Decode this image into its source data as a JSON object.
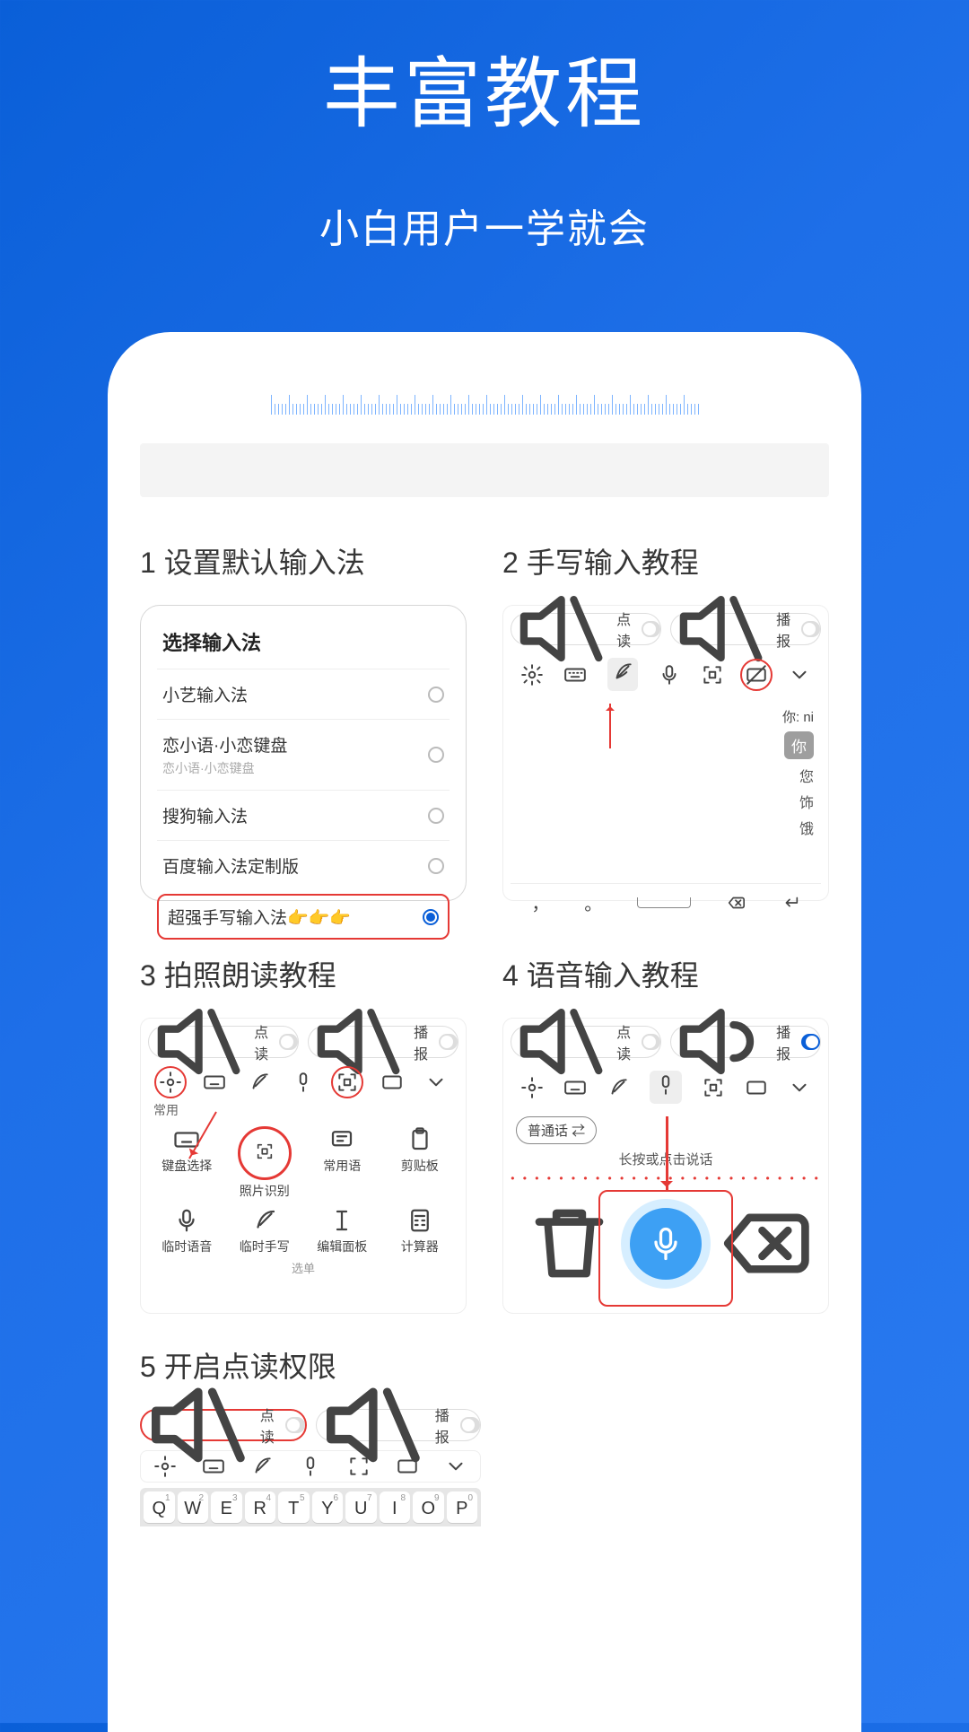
{
  "hero": {
    "title": "丰富教程",
    "subtitle": "小白用户一学就会"
  },
  "tiles": {
    "t1": {
      "title": "1 设置默认输入法",
      "header": "选择输入法",
      "row1": "小艺输入法",
      "row2": "恋小语·小恋键盘",
      "row2sub": "恋小语·小恋键盘",
      "row3": "搜狗输入法",
      "row4": "百度输入法定制版",
      "row5": "超强手写输入法👉👉👉"
    },
    "t2": {
      "title": "2 手写输入教程",
      "toggle1": "点读",
      "toggle2": "播报",
      "pinyin_label": "你: ni",
      "c1": "你",
      "c2": "您",
      "c3": "饰",
      "c4": "饿",
      "f1": "，",
      "f2": "。"
    },
    "t3": {
      "title": "3 拍照朗读教程",
      "tab": "常用",
      "toggle1": "点读",
      "toggle2": "播报",
      "g1": "键盘选择",
      "g2": "照片识别",
      "g3": "常用语",
      "g4": "剪贴板",
      "g5": "临时语音",
      "g6": "临时手写",
      "g7": "编辑面板",
      "g8": "计算器",
      "more": "选单"
    },
    "t4": {
      "title": "4 语音输入教程",
      "toggle1": "点读",
      "toggle2": "播报",
      "chip": "普通话 ⇄",
      "hint": "长按或点击说话"
    },
    "t5": {
      "title": "5 开启点读权限",
      "toggle1": "点读",
      "toggle2": "播报",
      "keys": [
        "Q",
        "W",
        "E",
        "R",
        "T",
        "Y",
        "U",
        "I",
        "O",
        "P"
      ],
      "sups": [
        "1",
        "2",
        "3",
        "4",
        "5",
        "6",
        "7",
        "8",
        "9",
        "0"
      ]
    }
  }
}
